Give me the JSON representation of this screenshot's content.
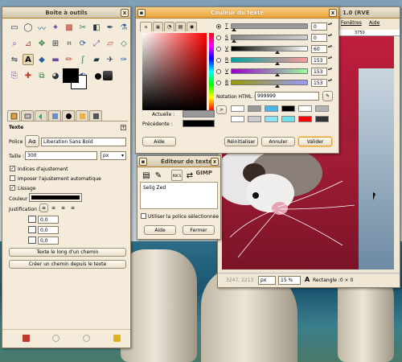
{
  "colors": {
    "accent": "#e9a239",
    "selected_fg": "#000000",
    "old_fg": "#000000",
    "html_value_color": "#999999",
    "canvas_red": "#b0213a"
  },
  "toolbox": {
    "title": "Boîte à outils",
    "close": "x",
    "tools": [
      "rect-select-icon",
      "ellipse-select-icon",
      "free-select-icon",
      "fuzzy-select-icon",
      "color-select-icon",
      "scissors-icon",
      "foreground-select-icon",
      "paths-icon",
      "color-picker-icon",
      "zoom-icon",
      "measure-icon",
      "move-icon",
      "align-icon",
      "crop-icon",
      "rotate-icon",
      "scale-icon",
      "shear-icon",
      "perspective-icon",
      "flip-icon",
      "text-icon",
      "bucket-fill-icon",
      "blend-icon",
      "pencil-icon",
      "paintbrush-icon",
      "eraser-icon",
      "airbrush-icon",
      "ink-icon",
      "clone-icon",
      "heal-icon",
      "perspective-clone-icon",
      "blur-icon",
      "smudge-icon",
      "dodge-icon"
    ],
    "options_title": "Texte",
    "font_label": "Police :",
    "font_icon": "Aα",
    "font_value": "Liberation Sans Bold",
    "size_label": "Taille :",
    "size_value": "300",
    "size_unit": "px",
    "hinting": "Indices d'ajustement",
    "autohint": "Imposer l'ajustement automatique",
    "antialias": "Lissage",
    "color_label": "Couleur :",
    "justify_label": "Justification :",
    "indent_value": "0,0",
    "line_spacing_value": "0,0",
    "letter_spacing_value": "0,0",
    "text_along_path": "Texte le long d'un chemin",
    "path_from_text": "Créer un chemin depuis le texte"
  },
  "color_dialog": {
    "title": "Couleur du texte",
    "current_label": "Actuelle :",
    "previous_label": "Précédente :",
    "channels": [
      {
        "label": "T",
        "value": "0",
        "checked": true
      },
      {
        "label": "S",
        "value": "0",
        "checked": false
      },
      {
        "label": "V",
        "value": "60",
        "checked": false
      },
      {
        "label": "R",
        "value": "153",
        "checked": false
      },
      {
        "label": "V",
        "value": "153",
        "checked": false
      },
      {
        "label": "B",
        "value": "153",
        "checked": false
      }
    ],
    "html_label": "Notation HTML :",
    "html_value": "999999",
    "history_arrow": ">",
    "history_colors": [
      "#ffffff",
      "#999999",
      "#4eb3e6",
      "#000000",
      "#ffffff",
      "#b3b3b3",
      "#ffffff",
      "#cccccc",
      "#8fe0f0",
      "#6ee0f0",
      "#ff0000",
      "#333333"
    ],
    "help": "Aide",
    "reset": "Réinitialiser",
    "cancel": "Annuler",
    "ok": "Valider"
  },
  "text_editor": {
    "title": "Éditeur de texte GIMP",
    "close": "x",
    "tab_labels": [
      "",
      "",
      "RBCS",
      ""
    ],
    "content": "Selig Zed",
    "use_selected_font": "Utiliser la police sélectionnée",
    "help": "Aide",
    "close_button": "Fermer"
  },
  "image_window": {
    "title_fragment": "1.0 (RVE",
    "menus": [
      "Fenêtres",
      "Aide"
    ],
    "ruler_label": "3750",
    "coords": "3247, 2213",
    "unit": "px",
    "zoom": "15 %",
    "status": "Rectangle :0 × 0",
    "status_icon": "A"
  }
}
